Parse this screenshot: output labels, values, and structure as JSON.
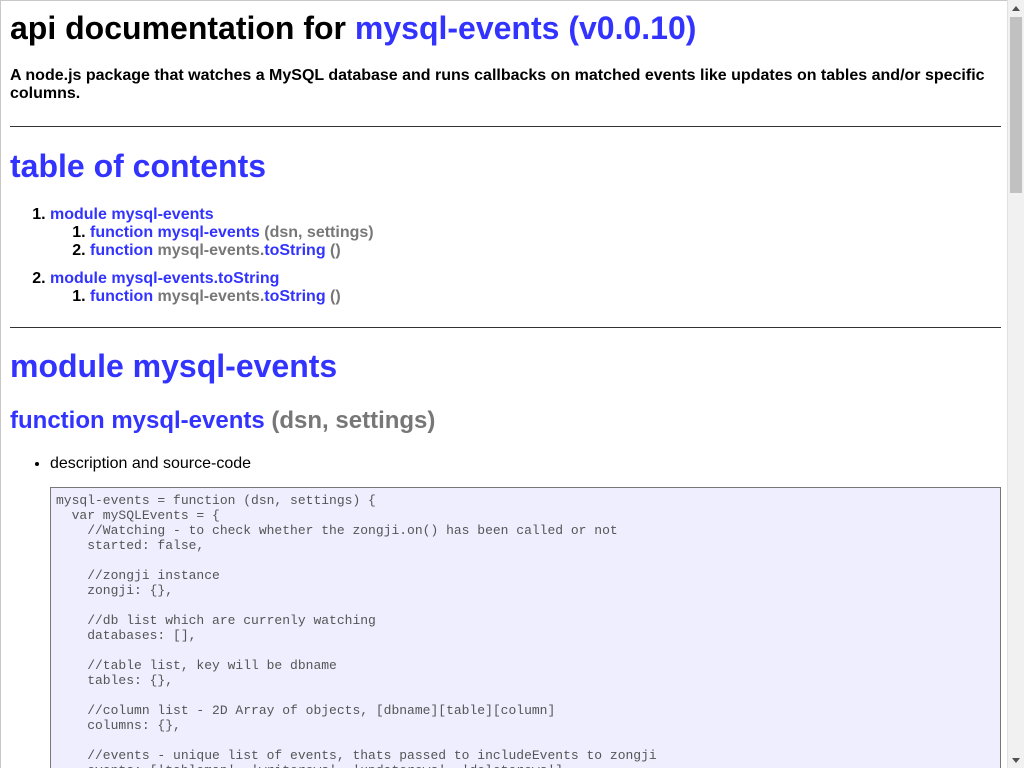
{
  "header": {
    "prefix": "api documentation for ",
    "package_link": "mysql-events (v0.0.10)",
    "description": "A node.js package that watches a MySQL database and runs callbacks on matched events like updates on tables and/or specific columns."
  },
  "toc": {
    "title": "table of contents",
    "items": [
      {
        "label": "module mysql-events",
        "children": [
          {
            "kw": "function",
            "name_gray": "",
            "name": "mysql-events",
            "args": " (dsn, settings)"
          },
          {
            "kw": "function",
            "name_gray": "mysql-events.",
            "name": "toString",
            "args": " ()"
          }
        ]
      },
      {
        "label": "module mysql-events.toString",
        "children": [
          {
            "kw": "function",
            "name_gray": "mysql-events.",
            "name": "toString",
            "args": " ()"
          }
        ]
      }
    ]
  },
  "module": {
    "title": "module mysql-events",
    "function": {
      "kw": "function",
      "name": "mysql-events",
      "args": " (dsn, settings)"
    },
    "bullet": "description and source-code",
    "code": "mysql-events = function (dsn, settings) {\n  var mySQLEvents = {\n    //Watching - to check whether the zongji.on() has been called or not\n    started: false,\n\n    //zongji instance\n    zongji: {},\n\n    //db list which are currenly watching\n    databases: [],\n\n    //table list, key will be dbname\n    tables: {},\n\n    //column list - 2D Array of objects, [dbname][table][column]\n    columns: {},\n\n    //events - unique list of events, thats passed to includeEvents to zongji\n    events: ['tablemap', 'writerows', 'updaterows', 'deleterows'],"
  }
}
